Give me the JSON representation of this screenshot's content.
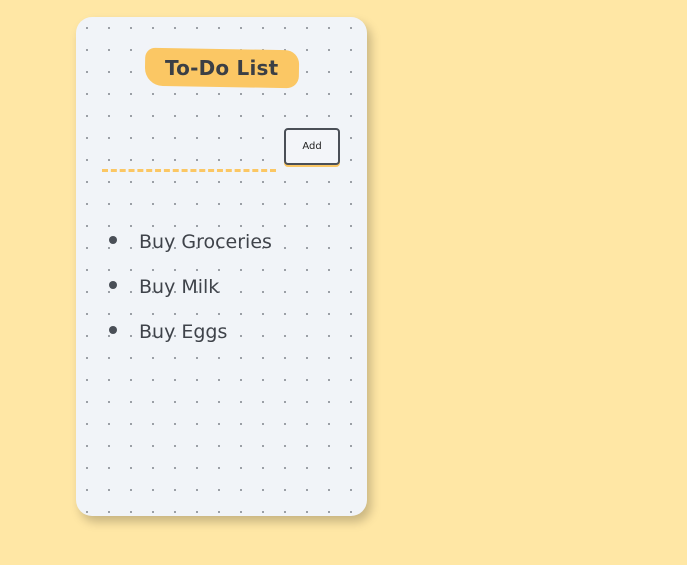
{
  "app": {
    "title": "To-Do List"
  },
  "form": {
    "input_value": "",
    "add_label": "Add"
  },
  "todos": [
    {
      "label": "Buy Groceries"
    },
    {
      "label": "Buy Milk"
    },
    {
      "label": "Buy Eggs"
    }
  ],
  "colors": {
    "page_background": "#ffe7a5",
    "card_background": "#f1f4f8",
    "accent": "#fbc764",
    "text": "#3f434a"
  }
}
